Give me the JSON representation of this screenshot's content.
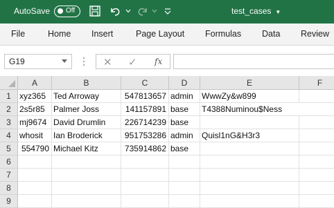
{
  "titlebar": {
    "autosave_label": "AutoSave",
    "autosave_state": "Off",
    "doc_title": "test_cases",
    "icons": [
      "save-icon",
      "undo-icon",
      "redo-icon",
      "customize-toolbar-icon"
    ],
    "accent_color": "#217346"
  },
  "ribbon": {
    "tabs": [
      "File",
      "Home",
      "Insert",
      "Page Layout",
      "Formulas",
      "Data",
      "Review"
    ]
  },
  "formula_bar": {
    "name_box": "G19",
    "cancel_symbol": "✕",
    "enter_symbol": "✓",
    "fx_label": "fx",
    "formula_value": ""
  },
  "sheet": {
    "columns": [
      "A",
      "B",
      "C",
      "D",
      "E",
      "F"
    ],
    "rows": [
      {
        "num": "1",
        "cells": [
          "xyz365",
          "Ted Arroway",
          "547813657",
          "admin",
          "WwwZy&w899",
          ""
        ]
      },
      {
        "num": "2",
        "cells": [
          "2s5r85",
          "Palmer Joss",
          "141157891",
          "base",
          "T4388Numinou$Ness",
          ""
        ]
      },
      {
        "num": "3",
        "cells": [
          "mj9674",
          "David Drumlin",
          "226714239",
          "base",
          "",
          ""
        ]
      },
      {
        "num": "4",
        "cells": [
          "whosit",
          "Ian Broderick",
          "951753286",
          "admin",
          "Quisl1nG&H3r3",
          ""
        ]
      },
      {
        "num": "5",
        "cells": [
          "554790",
          "Michael Kitz",
          "735914862",
          "base",
          "",
          ""
        ]
      },
      {
        "num": "6",
        "cells": [
          "",
          "",
          "",
          "",
          "",
          ""
        ]
      },
      {
        "num": "7",
        "cells": [
          "",
          "",
          "",
          "",
          "",
          ""
        ]
      },
      {
        "num": "8",
        "cells": [
          "",
          "",
          "",
          "",
          "",
          ""
        ]
      },
      {
        "num": "9",
        "cells": [
          "",
          "",
          "",
          "",
          "",
          ""
        ]
      }
    ]
  }
}
